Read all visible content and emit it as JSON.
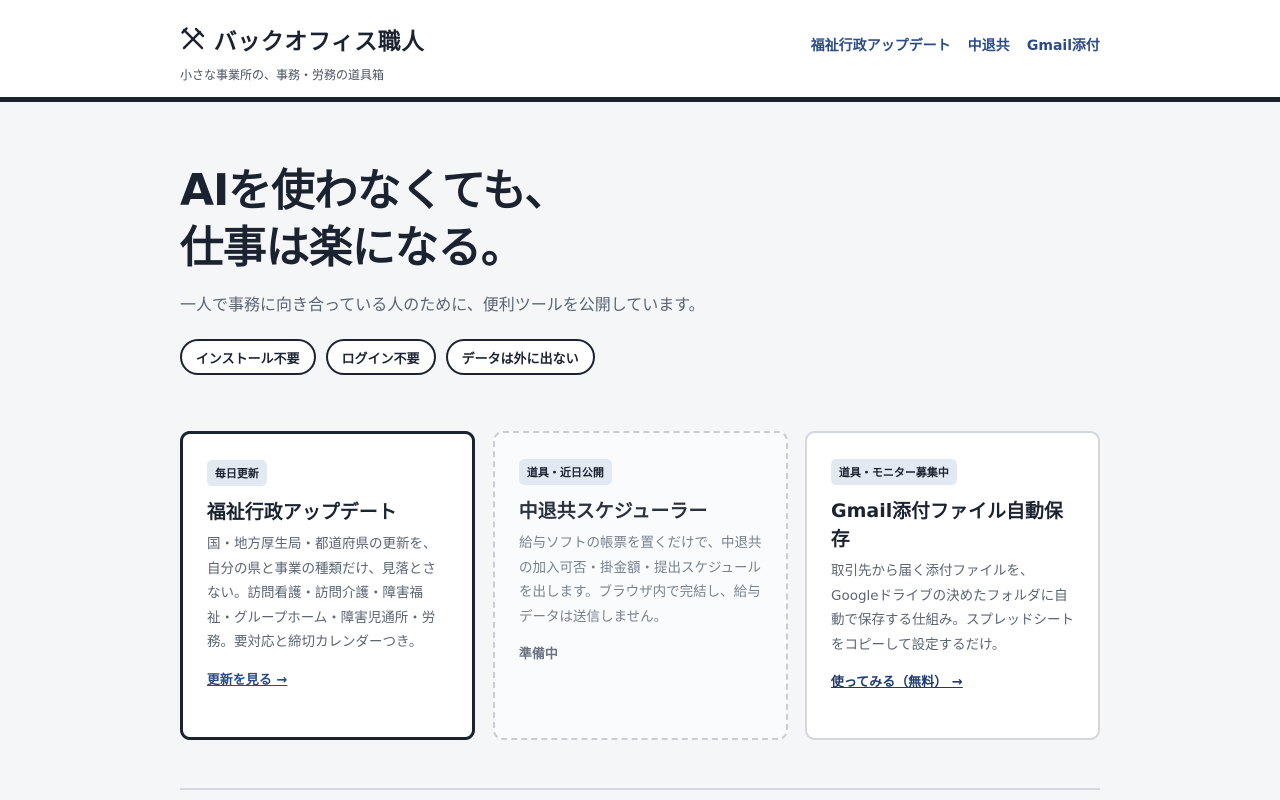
{
  "brand": {
    "title": "バックオフィス職人",
    "subtitle": "小さな事業所の、事務・労務の道具箱",
    "icon": "tools-icon"
  },
  "nav": [
    {
      "label": "福祉行政アップデート"
    },
    {
      "label": "中退共"
    },
    {
      "label": "Gmail添付"
    }
  ],
  "hero": {
    "title_line1": "AIを使わなくても、",
    "title_line2": "仕事は楽になる。",
    "subtitle": "一人で事務に向き合っている人のために、便利ツールを公開しています。"
  },
  "pills": [
    {
      "label": "インストール不要"
    },
    {
      "label": "ログイン不要"
    },
    {
      "label": "データは外に出ない"
    }
  ],
  "cards": [
    {
      "badge": "毎日更新",
      "title": "福祉行政アップデート",
      "description": "国・地方厚生局・都道府県の更新を、自分の県と事業の種類だけ、見落とさない。訪問看護・訪問介護・障害福祉・グループホーム・障害児通所・労務。要対応と締切カレンダーつき。",
      "link": "更新を見る →"
    },
    {
      "badge": "道具・近日公開",
      "title": "中退共スケジューラー",
      "description": "給与ソフトの帳票を置くだけで、中退共の加入可否・掛金額・提出スケジュールを出します。ブラウザ内で完結し、給与データは送信しません。",
      "link": "準備中"
    },
    {
      "badge": "道具・モニター募集中",
      "title": "Gmail添付ファイル自動保存",
      "description": "取引先から届く添付ファイルを、Googleドライブの決めたフォルダに自動で保存する仕組み。スプレッドシートをコピーして設定するだけ。",
      "link": "使ってみる（無料） →"
    }
  ],
  "colors": {
    "dark": "#1b2230",
    "link": "#2b4a86",
    "badge_bg": "#e3e9f3",
    "page_bg": "#f4f6f8"
  }
}
